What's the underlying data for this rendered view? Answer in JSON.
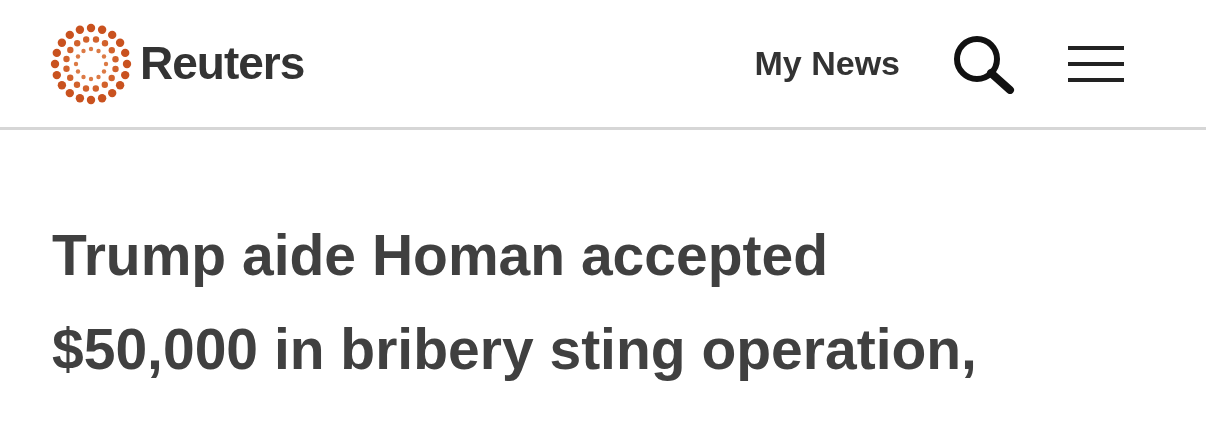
{
  "header": {
    "brand": "Reuters",
    "my_news": "My News"
  },
  "headline_lines": [
    "Trump aide Homan accepted",
    "$50,000 in bribery sting operation,"
  ]
}
